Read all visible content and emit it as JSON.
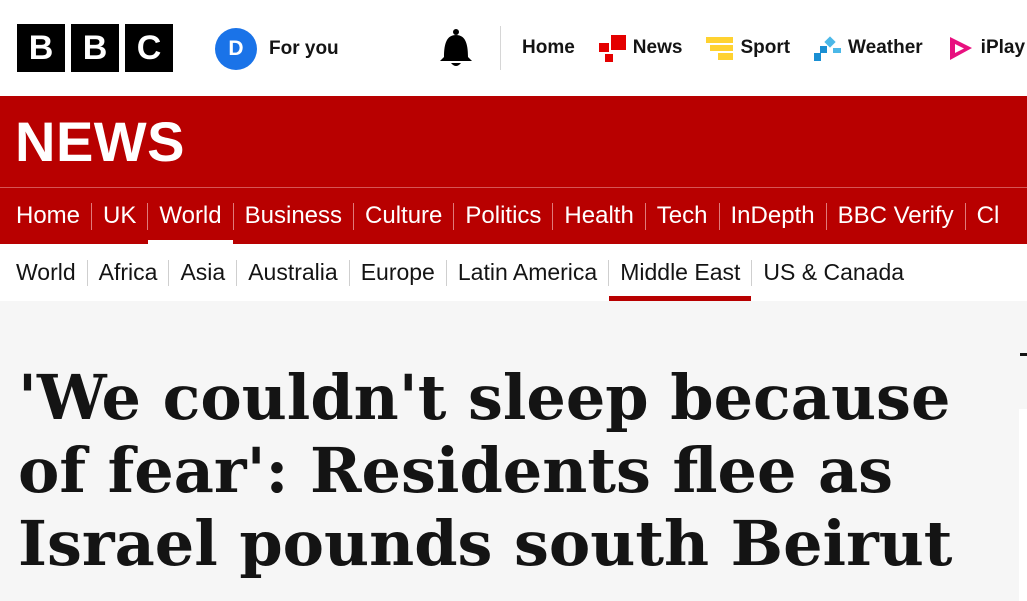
{
  "masthead": {
    "logo_letters": [
      "B",
      "B",
      "C"
    ],
    "account": {
      "initial": "D",
      "label": "For you",
      "avatar_color": "#1a73e8"
    },
    "notifications_icon": "bell-icon",
    "nav": [
      {
        "label": "Home",
        "icon": ""
      },
      {
        "label": "News",
        "icon": "news-icon",
        "icon_color": "#e40000"
      },
      {
        "label": "Sport",
        "icon": "sport-icon",
        "icon_color": "#ffd230"
      },
      {
        "label": "Weather",
        "icon": "weather-icon",
        "icon_color": "#1a8fd3"
      },
      {
        "label": "iPlay",
        "icon": "iplayer-icon",
        "icon_color": "#e8107f"
      }
    ]
  },
  "news_banner": {
    "title": "NEWS",
    "color": "#b80000"
  },
  "primary_nav": {
    "items": [
      "Home",
      "UK",
      "World",
      "Business",
      "Culture",
      "Politics",
      "Health",
      "Tech",
      "InDepth",
      "BBC Verify",
      "Cl"
    ],
    "active": "World"
  },
  "secondary_nav": {
    "items": [
      "World",
      "Africa",
      "Asia",
      "Australia",
      "Europe",
      "Latin America",
      "Middle East",
      "US & Canada"
    ],
    "active": "Middle East"
  },
  "article": {
    "headline": "'We couldn't sleep because of fear': Residents flee as Israel pounds south Beirut"
  }
}
